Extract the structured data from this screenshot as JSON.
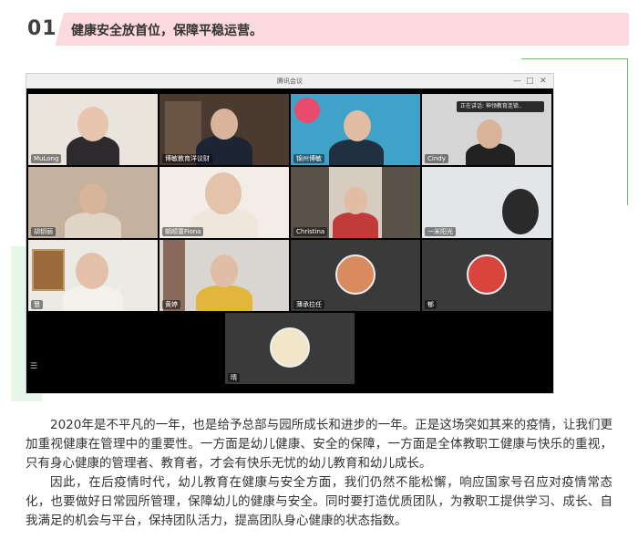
{
  "section": {
    "number": "01",
    "heading": "健康安全放首位，保障平稳运营。"
  },
  "meeting": {
    "title": "腾讯会议",
    "tooltip": "正在讲话: 神领教育连锁..",
    "participants": [
      "MuLong",
      "博敏教育洋议财",
      "锦州博敏",
      "Cindy",
      "胡钥丽",
      "朝顺童Fiona",
      "Christina",
      "一米阳光",
      "慧",
      "黄婷",
      "薄承拉任",
      "郁",
      "晴"
    ]
  },
  "paragraphs": [
    "2020年是不平凡的一年，也是给予总部与园所成长和进步的一年。正是这场突如其来的疫情，让我们更加重视健康在管理中的重要性。一方面是幼儿健康、安全的保障，一方面是全体教职工健康与快乐的重视，只有身心健康的管理者、教育者，才会有快乐无忧的幼儿教育和幼儿成长。",
    "因此，在后疫情时代，幼儿教育在健康与安全方面，我们仍然不能松懈，响应国家号召应对疫情常态化，也要做好日常园所管理，保障幼儿的健康与安全。同时要打造优质团队，为教职工提供学习、成长、自我满足的机会与平台，保持团队活力，提高团队身心健康的状态指数。"
  ],
  "colors": {
    "header_bg": "#fbd9dd",
    "accent_green": "#6fbf73"
  }
}
